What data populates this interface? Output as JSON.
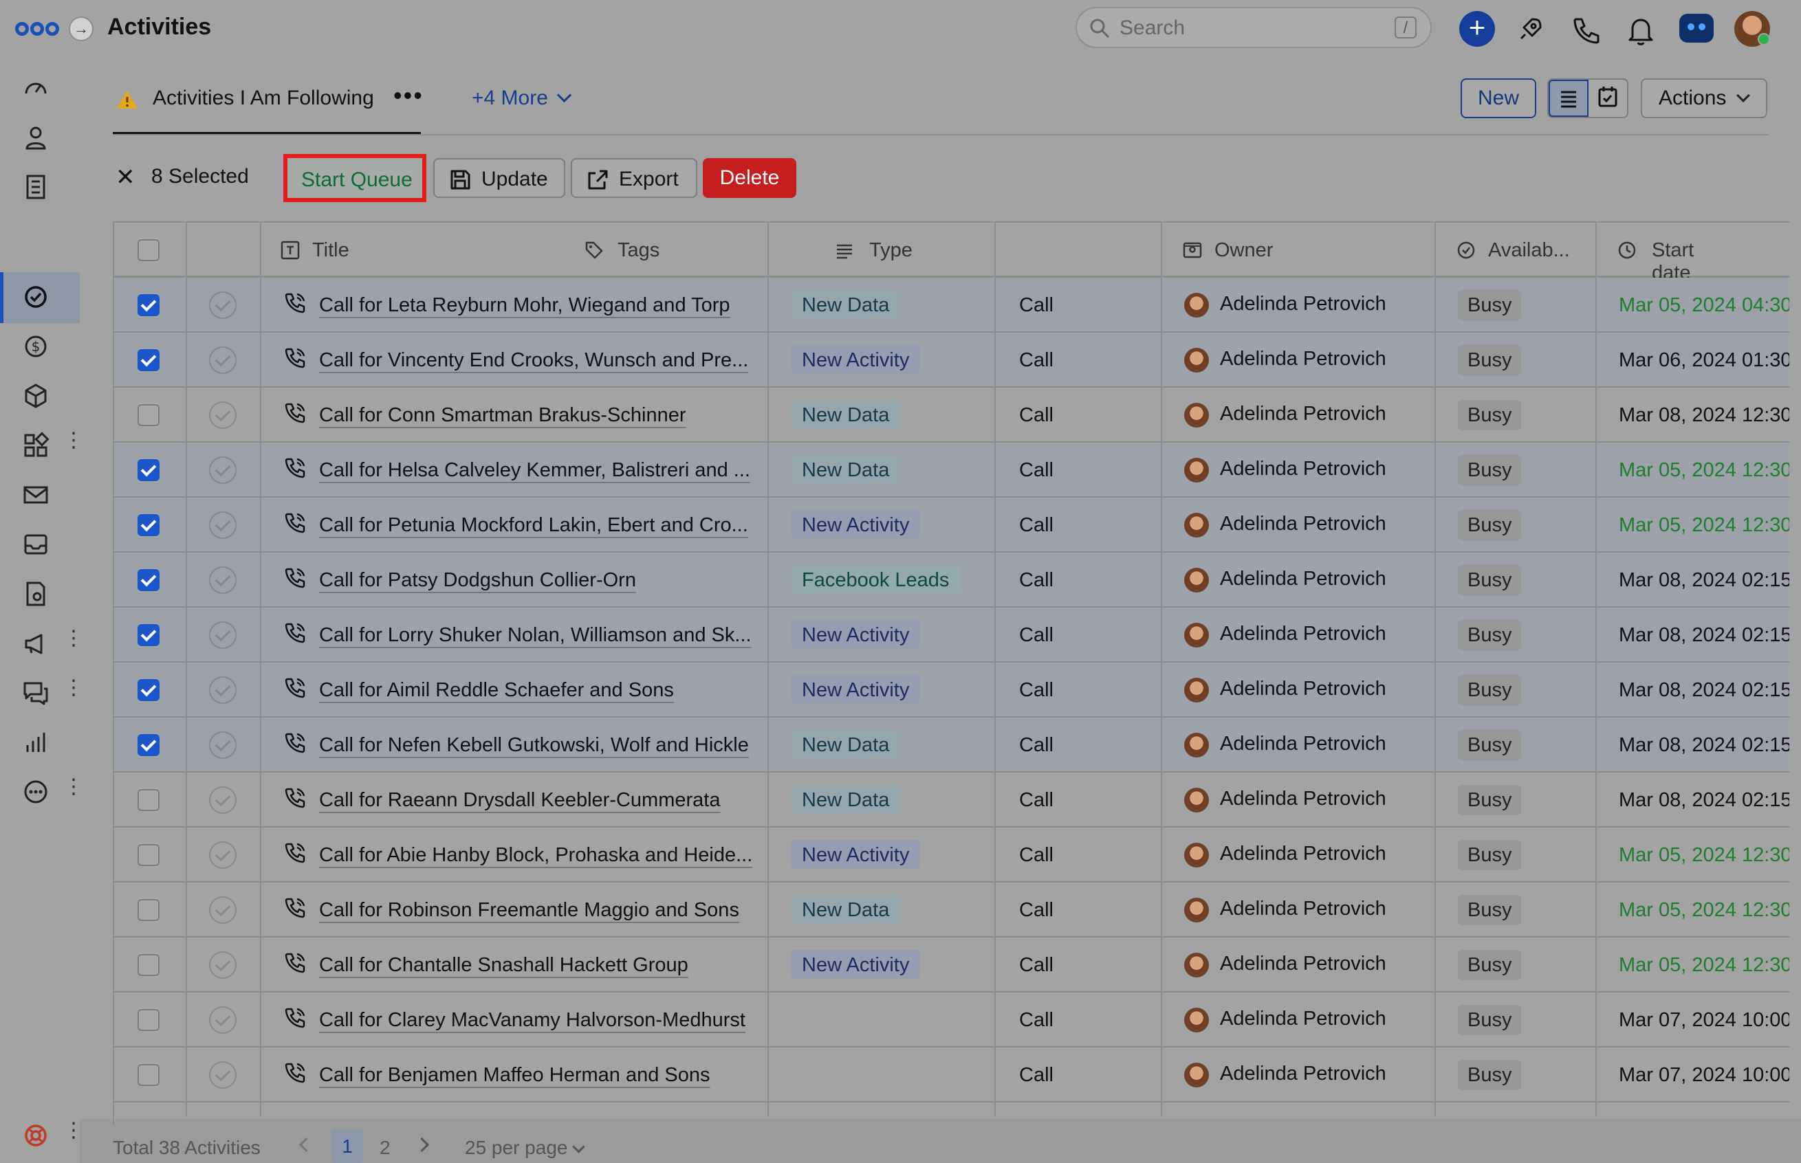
{
  "app": {
    "title": "Activities"
  },
  "topbar": {
    "search_placeholder": "Search",
    "search_shortcut": "/",
    "icons": [
      "plus-icon",
      "rocket-icon",
      "phone-icon",
      "bell-icon",
      "assistant-icon",
      "user-avatar"
    ]
  },
  "sidebar": {
    "items": [
      "dashboard-icon",
      "contacts-icon",
      "companies-icon",
      "activities-icon",
      "deals-icon",
      "products-icon",
      "apps-icon",
      "email-icon",
      "inbox-icon",
      "documents-icon",
      "campaigns-icon",
      "conversations-icon",
      "reports-icon",
      "more-icon",
      "help-icon"
    ],
    "active": "activities-icon"
  },
  "view": {
    "title": "Activities I Am Following",
    "more_views": "+4 More",
    "new_label": "New",
    "actions_label": "Actions"
  },
  "selection": {
    "count_label": "8 Selected",
    "start_queue_label": "Start Queue",
    "update_label": "Update",
    "export_label": "Export",
    "delete_label": "Delete"
  },
  "table": {
    "columns": [
      "Title",
      "Tags",
      "Type",
      "Owner",
      "Availab...",
      "Start date"
    ],
    "rows": [
      {
        "checked": true,
        "title": "Call for Leta Reyburn Mohr, Wiegand and Torp",
        "tag": "New Data",
        "tag_kind": "data",
        "type": "Call",
        "owner": "Adelinda Petrovich",
        "availability": "Busy",
        "start": "Mar 05, 2024 04:30",
        "start_color": "green"
      },
      {
        "checked": true,
        "title": "Call for Vincenty End Crooks, Wunsch and Pre...",
        "tag": "New Activity",
        "tag_kind": "activity",
        "type": "Call",
        "owner": "Adelinda Petrovich",
        "availability": "Busy",
        "start": "Mar 06, 2024 01:30",
        "start_color": "default"
      },
      {
        "checked": false,
        "title": "Call for Conn Smartman Brakus-Schinner",
        "tag": "New Data",
        "tag_kind": "data",
        "type": "Call",
        "owner": "Adelinda Petrovich",
        "availability": "Busy",
        "start": "Mar 08, 2024 12:30",
        "start_color": "default"
      },
      {
        "checked": true,
        "title": "Call for Helsa Calveley Kemmer, Balistreri and ...",
        "tag": "New Data",
        "tag_kind": "data",
        "type": "Call",
        "owner": "Adelinda Petrovich",
        "availability": "Busy",
        "start": "Mar 05, 2024 12:30",
        "start_color": "green"
      },
      {
        "checked": true,
        "title": "Call for Petunia Mockford Lakin, Ebert and Cro...",
        "tag": "New Activity",
        "tag_kind": "activity",
        "type": "Call",
        "owner": "Adelinda Petrovich",
        "availability": "Busy",
        "start": "Mar 05, 2024 12:30",
        "start_color": "green"
      },
      {
        "checked": true,
        "title": "Call for Patsy Dodgshun Collier-Orn",
        "tag": "Facebook Leads",
        "tag_kind": "fb",
        "type": "Call",
        "owner": "Adelinda Petrovich",
        "availability": "Busy",
        "start": "Mar 08, 2024 02:15",
        "start_color": "default"
      },
      {
        "checked": true,
        "title": "Call for Lorry Shuker Nolan, Williamson and Sk...",
        "tag": "New Activity",
        "tag_kind": "activity",
        "type": "Call",
        "owner": "Adelinda Petrovich",
        "availability": "Busy",
        "start": "Mar 08, 2024 02:15",
        "start_color": "default"
      },
      {
        "checked": true,
        "title": "Call for Aimil Reddle Schaefer and Sons",
        "tag": "New Activity",
        "tag_kind": "activity",
        "type": "Call",
        "owner": "Adelinda Petrovich",
        "availability": "Busy",
        "start": "Mar 08, 2024 02:15",
        "start_color": "default"
      },
      {
        "checked": true,
        "title": "Call for Nefen Kebell Gutkowski, Wolf and Hickle",
        "tag": "New Data",
        "tag_kind": "data",
        "type": "Call",
        "owner": "Adelinda Petrovich",
        "availability": "Busy",
        "start": "Mar 08, 2024 02:15",
        "start_color": "default"
      },
      {
        "checked": false,
        "title": "Call for Raeann Drysdall Keebler-Cummerata",
        "tag": "New Data",
        "tag_kind": "data",
        "type": "Call",
        "owner": "Adelinda Petrovich",
        "availability": "Busy",
        "start": "Mar 08, 2024 02:15",
        "start_color": "default"
      },
      {
        "checked": false,
        "title": "Call for Abie Hanby Block, Prohaska and Heide...",
        "tag": "New Activity",
        "tag_kind": "activity",
        "type": "Call",
        "owner": "Adelinda Petrovich",
        "availability": "Busy",
        "start": "Mar 05, 2024 12:30",
        "start_color": "green"
      },
      {
        "checked": false,
        "title": "Call for Robinson Freemantle Maggio and Sons",
        "tag": "New Data",
        "tag_kind": "data",
        "type": "Call",
        "owner": "Adelinda Petrovich",
        "availability": "Busy",
        "start": "Mar 05, 2024 12:30",
        "start_color": "green"
      },
      {
        "checked": false,
        "title": "Call for Chantalle Snashall Hackett Group",
        "tag": "New Activity",
        "tag_kind": "activity",
        "type": "Call",
        "owner": "Adelinda Petrovich",
        "availability": "Busy",
        "start": "Mar 05, 2024 12:30",
        "start_color": "green"
      },
      {
        "checked": false,
        "title": "Call for Clarey MacVanamy Halvorson-Medhurst",
        "tag": "",
        "tag_kind": "none",
        "type": "Call",
        "owner": "Adelinda Petrovich",
        "availability": "Busy",
        "start": "Mar 07, 2024 10:00",
        "start_color": "default"
      },
      {
        "checked": false,
        "title": "Call for Benjamen Maffeo Herman and Sons",
        "tag": "",
        "tag_kind": "none",
        "type": "Call",
        "owner": "Adelinda Petrovich",
        "availability": "Busy",
        "start": "Mar 07, 2024 10:00",
        "start_color": "default"
      }
    ]
  },
  "footer": {
    "total": "Total 38 Activities",
    "pages": [
      "1",
      "2"
    ],
    "current_page": "1",
    "per_page": "25 per page"
  },
  "colors": {
    "accent": "#1b56c9",
    "delete": "#c41e1e",
    "highlight_border": "#e41c1c",
    "date_green": "#1f7d2f"
  }
}
